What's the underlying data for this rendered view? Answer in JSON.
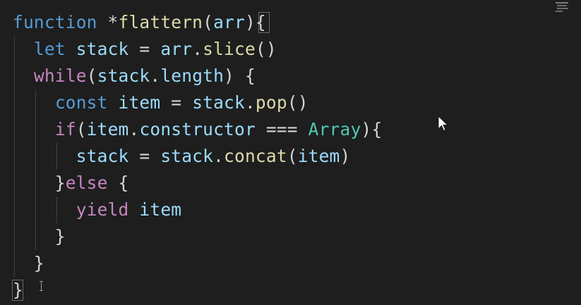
{
  "editor": {
    "language": "javascript",
    "lines": [
      {
        "tokens": [
          {
            "text": "function",
            "kind": "kw-blue"
          },
          {
            "text": " *",
            "kind": "punct"
          },
          {
            "text": "flattern",
            "kind": "fn"
          },
          {
            "text": "(",
            "kind": "punct"
          },
          {
            "text": "arr",
            "kind": "ident"
          },
          {
            "text": "){",
            "kind": "punct"
          }
        ]
      },
      {
        "tokens": [
          {
            "text": "  ",
            "kind": "punct"
          },
          {
            "text": "let",
            "kind": "kw-blue"
          },
          {
            "text": " ",
            "kind": "punct"
          },
          {
            "text": "stack",
            "kind": "ident"
          },
          {
            "text": " = ",
            "kind": "punct"
          },
          {
            "text": "arr",
            "kind": "ident"
          },
          {
            "text": ".",
            "kind": "punct"
          },
          {
            "text": "slice",
            "kind": "fn"
          },
          {
            "text": "()",
            "kind": "punct"
          }
        ]
      },
      {
        "tokens": [
          {
            "text": "  ",
            "kind": "punct"
          },
          {
            "text": "while",
            "kind": "kw-purple"
          },
          {
            "text": "(",
            "kind": "punct"
          },
          {
            "text": "stack",
            "kind": "ident"
          },
          {
            "text": ".",
            "kind": "punct"
          },
          {
            "text": "length",
            "kind": "ident"
          },
          {
            "text": ") {",
            "kind": "punct"
          }
        ]
      },
      {
        "tokens": [
          {
            "text": "    ",
            "kind": "punct"
          },
          {
            "text": "const",
            "kind": "kw-blue"
          },
          {
            "text": " ",
            "kind": "punct"
          },
          {
            "text": "item",
            "kind": "ident"
          },
          {
            "text": " = ",
            "kind": "punct"
          },
          {
            "text": "stack",
            "kind": "ident"
          },
          {
            "text": ".",
            "kind": "punct"
          },
          {
            "text": "pop",
            "kind": "fn"
          },
          {
            "text": "()",
            "kind": "punct"
          }
        ]
      },
      {
        "tokens": [
          {
            "text": "    ",
            "kind": "punct"
          },
          {
            "text": "if",
            "kind": "kw-purple"
          },
          {
            "text": "(",
            "kind": "punct"
          },
          {
            "text": "item",
            "kind": "ident"
          },
          {
            "text": ".",
            "kind": "punct"
          },
          {
            "text": "constructor",
            "kind": "ident"
          },
          {
            "text": " === ",
            "kind": "punct"
          },
          {
            "text": "Array",
            "kind": "type"
          },
          {
            "text": "){",
            "kind": "punct"
          }
        ]
      },
      {
        "tokens": [
          {
            "text": "      ",
            "kind": "punct"
          },
          {
            "text": "stack",
            "kind": "ident"
          },
          {
            "text": " = ",
            "kind": "punct"
          },
          {
            "text": "stack",
            "kind": "ident"
          },
          {
            "text": ".",
            "kind": "punct"
          },
          {
            "text": "concat",
            "kind": "fn"
          },
          {
            "text": "(",
            "kind": "punct"
          },
          {
            "text": "item",
            "kind": "ident"
          },
          {
            "text": ")",
            "kind": "punct"
          }
        ]
      },
      {
        "tokens": [
          {
            "text": "    }",
            "kind": "punct"
          },
          {
            "text": "else",
            "kind": "kw-purple"
          },
          {
            "text": " {",
            "kind": "punct"
          }
        ]
      },
      {
        "tokens": [
          {
            "text": "      ",
            "kind": "punct"
          },
          {
            "text": "yield",
            "kind": "kw-purple"
          },
          {
            "text": " ",
            "kind": "punct"
          },
          {
            "text": "item",
            "kind": "ident"
          }
        ]
      },
      {
        "tokens": [
          {
            "text": "    }",
            "kind": "punct"
          }
        ]
      },
      {
        "tokens": [
          {
            "text": "  }",
            "kind": "punct"
          }
        ]
      },
      {
        "tokens": [
          {
            "text": "}",
            "kind": "punct"
          }
        ]
      }
    ]
  },
  "colors": {
    "background": "#1e1e1e",
    "keyword_blue": "#569cd6",
    "keyword_purple": "#c586c0",
    "identifier": "#9cdcfe",
    "function": "#dcdcaa",
    "type": "#4ec9b0",
    "punctuation": "#d4d4d4",
    "indent_guide": "#404040"
  },
  "icons": {
    "mouse_pointer": "mouse-pointer-icon",
    "text_cursor": "text-cursor-icon"
  }
}
